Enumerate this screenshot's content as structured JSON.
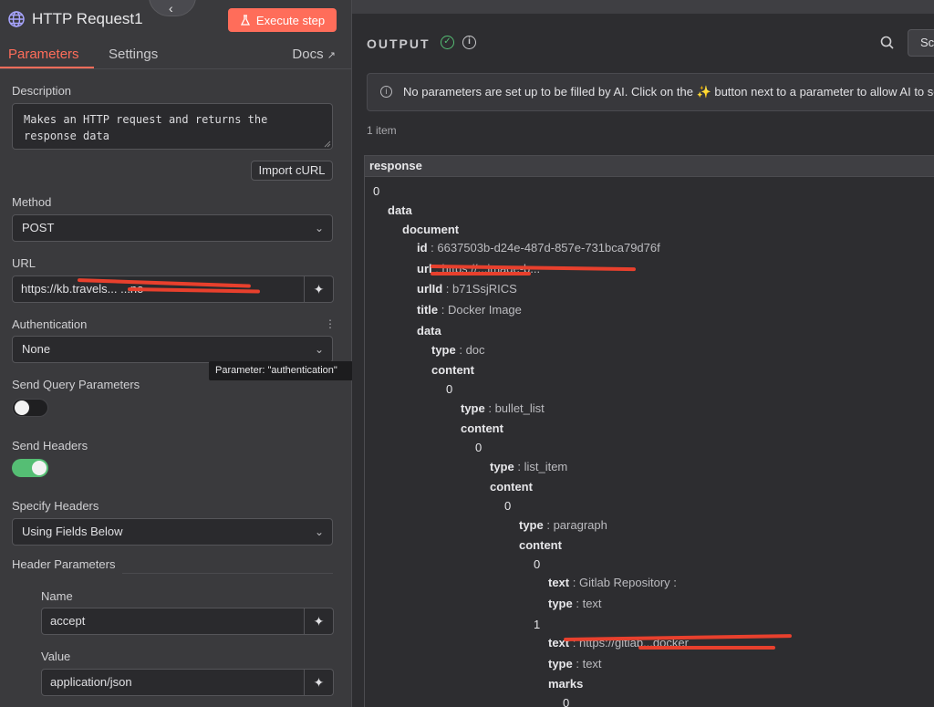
{
  "node": {
    "title": "HTTP Request1",
    "execute_label": "Execute step"
  },
  "tabs": [
    {
      "label": "Parameters"
    },
    {
      "label": "Settings"
    }
  ],
  "docs_label": "Docs",
  "params": {
    "description_label": "Description",
    "description_value": "Makes an HTTP request and returns the\nresponse data",
    "import_curl_label": "Import cURL",
    "method_label": "Method",
    "method_value": "POST",
    "url_label": "URL",
    "url_value": "https://kb.travels...                    ...no",
    "auth_label": "Authentication",
    "auth_value": "None",
    "auth_tooltip": "Parameter: \"authentication\"",
    "send_query_label": "Send Query Parameters",
    "send_headers_label": "Send Headers",
    "specify_headers_label": "Specify Headers",
    "specify_headers_value": "Using Fields Below",
    "header_params_label": "Header Parameters",
    "name_label": "Name",
    "name_value": "accept",
    "value_label": "Value",
    "value_value": "application/json"
  },
  "output": {
    "title": "OUTPUT",
    "sc_label": "Sc",
    "banner": "No parameters are set up to be filled by AI. Click on the ✨ button next to a parameter to allow AI to se",
    "items_count": "1 item",
    "column": "response",
    "rows": [
      {
        "key": "",
        "value": "0",
        "indent": 0
      },
      {
        "key": "data",
        "value": "",
        "indent": 1
      },
      {
        "key": "document",
        "value": "",
        "indent": 2
      },
      {
        "key": "id",
        "value": "6637503b-d24e-487d-857e-731bca79d76f",
        "indent": 3
      },
      {
        "key": "url",
        "value": "https://...image-b...",
        "indent": 3
      },
      {
        "key": "urlId",
        "value": "b71SsjRICS",
        "indent": 3
      },
      {
        "key": "title",
        "value": "Docker Image",
        "indent": 3
      },
      {
        "key": "data",
        "value": "",
        "indent": 3
      },
      {
        "key": "type",
        "value": "doc",
        "indent": 4
      },
      {
        "key": "content",
        "value": "",
        "indent": 4
      },
      {
        "key": "",
        "value": "0",
        "indent": 5
      },
      {
        "key": "type",
        "value": "bullet_list",
        "indent": 6
      },
      {
        "key": "content",
        "value": "",
        "indent": 6
      },
      {
        "key": "",
        "value": "0",
        "indent": 7
      },
      {
        "key": "type",
        "value": "list_item",
        "indent": 8
      },
      {
        "key": "content",
        "value": "",
        "indent": 8
      },
      {
        "key": "",
        "value": "0",
        "indent": 9
      },
      {
        "key": "type",
        "value": "paragraph",
        "indent": 10
      },
      {
        "key": "content",
        "value": "",
        "indent": 10
      },
      {
        "key": "",
        "value": "0",
        "indent": 11
      },
      {
        "key": "text",
        "value": "Gitlab Repository :",
        "indent": 12
      },
      {
        "key": "type",
        "value": "text",
        "indent": 12
      },
      {
        "key": "",
        "value": "1",
        "indent": 11
      },
      {
        "key": "text",
        "value": "https://gitlab...docker",
        "indent": 12
      },
      {
        "key": "type",
        "value": "text",
        "indent": 12
      },
      {
        "key": "marks",
        "value": "",
        "indent": 12
      },
      {
        "key": "",
        "value": "0",
        "indent": 13
      }
    ]
  },
  "colors": {
    "accent": "#ff6d5a",
    "success": "#55be74",
    "ai": "#a7a4ff"
  }
}
